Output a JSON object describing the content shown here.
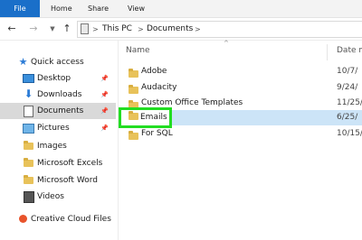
{
  "ribbon": {
    "tabs": [
      "File",
      "Home",
      "Share",
      "View"
    ]
  },
  "address_bar": {
    "crumbs": [
      "This PC",
      "Documents"
    ],
    "separator": ">"
  },
  "sidebar": {
    "items": [
      {
        "label": "Quick access",
        "icon": "star-icon"
      },
      {
        "label": "Desktop",
        "icon": "desktop-icon",
        "pinned": true
      },
      {
        "label": "Downloads",
        "icon": "download-icon",
        "pinned": true
      },
      {
        "label": "Documents",
        "icon": "documents-icon",
        "pinned": true,
        "selected": true
      },
      {
        "label": "Pictures",
        "icon": "pictures-icon",
        "pinned": true
      },
      {
        "label": "Images",
        "icon": "folder-icon"
      },
      {
        "label": "Microsoft Excels",
        "icon": "folder-icon"
      },
      {
        "label": "Microsoft Word",
        "icon": "folder-icon"
      },
      {
        "label": "Videos",
        "icon": "videos-icon"
      },
      {
        "label": "Creative Cloud Files",
        "icon": "creative-cloud-icon"
      }
    ]
  },
  "file_list": {
    "columns": {
      "name": "Name",
      "date": "Date m"
    },
    "rows": [
      {
        "name": "Adobe",
        "date": "10/7/"
      },
      {
        "name": "Audacity",
        "date": "9/24/"
      },
      {
        "name": "Custom Office Templates",
        "date": "11/25/"
      },
      {
        "name": "Emails",
        "date": "6/25/",
        "selected": true
      },
      {
        "name": "For SQL",
        "date": "10/15/"
      }
    ]
  },
  "colors": {
    "file_tab": "#1a6fc9",
    "highlight": "#22dd22",
    "selection": "#cce4f7",
    "folder": "#e8c25a"
  }
}
